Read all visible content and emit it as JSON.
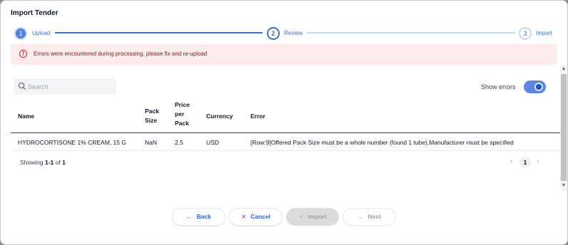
{
  "dialog": {
    "title": "Import Tender"
  },
  "stepper": {
    "steps": [
      {
        "number": "1",
        "label": "Upload",
        "state": "active"
      },
      {
        "number": "2",
        "label": "Review",
        "state": "current"
      },
      {
        "number": "3",
        "label": "Import",
        "state": "pending"
      }
    ]
  },
  "alert": {
    "message": "Errors were encountered during processing, please fix and re-upload",
    "icon": "error-circle-icon"
  },
  "search": {
    "placeholder": "Search",
    "value": ""
  },
  "toggle": {
    "label": "Show errors",
    "on": true
  },
  "table": {
    "headers": {
      "name": "Name",
      "pack_size": [
        "Pack",
        "Size"
      ],
      "price": [
        "Price",
        "per",
        "Pack"
      ],
      "currency": "Currency",
      "error": "Error"
    },
    "rows": [
      {
        "name": "HYDROCORTISONE 1% CREAM, 15 G",
        "pack_size": "NaN",
        "price": "2.5",
        "currency": "USD",
        "error": "[Row:9]Offered Pack Size must be a whole number (found 1 tube),Manufacturer must be specified"
      }
    ]
  },
  "pagination": {
    "prefix": "Showing ",
    "range": "1-1",
    "of": " of ",
    "total": "1",
    "page": "1",
    "prev": "‹",
    "next": "›"
  },
  "footer": {
    "back": "Back",
    "cancel": "Cancel",
    "import": "Import",
    "next": "Next"
  },
  "colors": {
    "accent": "#2563eb",
    "alert_bg": "#fdecec",
    "error": "#dc2626"
  }
}
